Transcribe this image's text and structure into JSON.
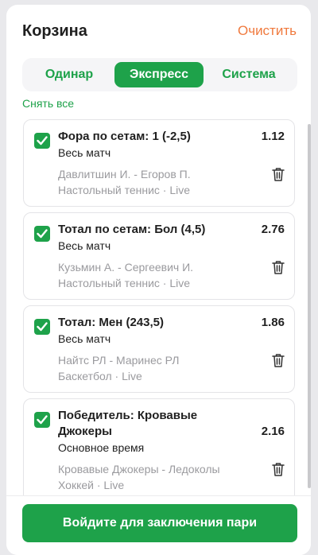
{
  "header": {
    "title": "Корзина",
    "clear_label": "Очистить"
  },
  "tabs": [
    {
      "label": "Одинар",
      "active": false
    },
    {
      "label": "Экспресс",
      "active": true
    },
    {
      "label": "Система",
      "active": false
    }
  ],
  "unselect_label": "Снять все",
  "bets": [
    {
      "market": "Фора по сетам: 1 (-2,5)",
      "period": "Весь матч",
      "odds": "1.12",
      "event": "Давлитшин И. - Егоров П.",
      "sport": "Настольный теннис · Live",
      "checked": true
    },
    {
      "market": "Тотал по сетам: Бол (4,5)",
      "period": "Весь матч",
      "odds": "2.76",
      "event": "Кузьмин А. - Сергеевич И.",
      "sport": "Настольный теннис · Live",
      "checked": true
    },
    {
      "market": "Тотал: Мен (243,5)",
      "period": "Весь матч",
      "odds": "1.86",
      "event": "Найтс РЛ - Маринес РЛ",
      "sport": "Баскетбол · Live",
      "checked": true
    },
    {
      "market": "Победитель: Кровавые Джокеры",
      "period": "Основное время",
      "odds": "2.16",
      "event": "Кровавые Джокеры - Ледоколы",
      "sport": "Хоккей · Live",
      "checked": true
    }
  ],
  "footer": {
    "login_label": "Войдите для заключения пари"
  },
  "colors": {
    "accent": "#1ea24a",
    "clear": "#f07a3e",
    "muted": "#9a9a9e"
  },
  "icons": {
    "check": "check-icon",
    "delete": "trash-icon"
  }
}
